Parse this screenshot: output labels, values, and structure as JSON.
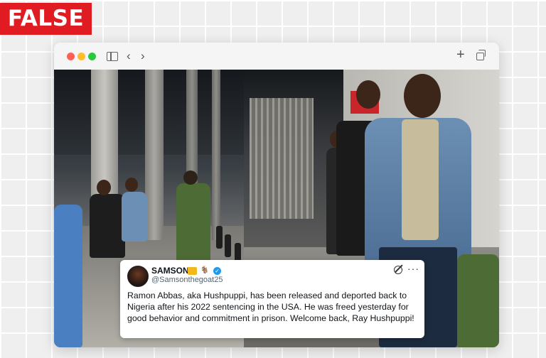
{
  "verdict": {
    "label": "FALSE",
    "color": "#e01b22"
  },
  "browser": {
    "controls": [
      "close",
      "minimize",
      "zoom"
    ],
    "icons": [
      "sidebar-icon",
      "back-chevron-icon",
      "forward-chevron-icon",
      "plus-icon",
      "tabs-icon"
    ],
    "back_glyph": "‹",
    "forward_glyph": "›",
    "plus_glyph": "+"
  },
  "tweet": {
    "name": "SAMSON",
    "handle": "@Samsonthegoat25",
    "badges": [
      "crown-badge-icon",
      "goat-emoji-icon",
      "verified-icon"
    ],
    "goat_glyph": "🐐",
    "verified_glyph": "✓",
    "more_glyph": "···",
    "text": "Ramon Abbas, aka Hushpuppi, has been released and deported back to Nigeria after his 2022 sentencing in the USA. He was freed yesterday for good behavior and commitment in prison. Welcome back, Ray Hushpuppi!"
  }
}
